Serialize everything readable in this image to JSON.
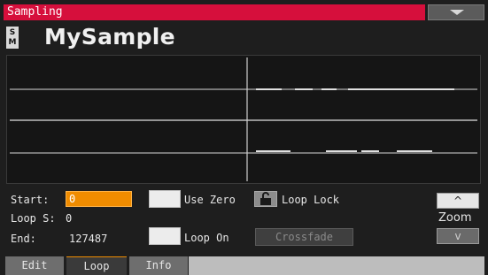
{
  "window": {
    "title": "Sampling",
    "menu_icon": "chevron-down-icon"
  },
  "header": {
    "badge": "S\nM",
    "sample_name": "MySample"
  },
  "waveform": {
    "channels": 2
  },
  "fields": {
    "start_label": "Start:",
    "start_value": "0",
    "loop_s_label": "Loop S:",
    "loop_s_value": "0",
    "end_label": "End:",
    "end_value": "127487",
    "use_zero_label": "Use Zero",
    "loop_lock_label": "Loop Lock",
    "loop_on_label": "Loop On",
    "crossfade_label": "Crossfade"
  },
  "zoom": {
    "label": "Zoom",
    "up": "^",
    "down": "v"
  },
  "tabs": [
    {
      "label": "Edit",
      "selected": false
    },
    {
      "label": "Loop",
      "selected": true
    },
    {
      "label": "Info",
      "selected": false
    }
  ],
  "colors": {
    "title_bar": "#d60f3c",
    "accent": "#f08c00"
  }
}
